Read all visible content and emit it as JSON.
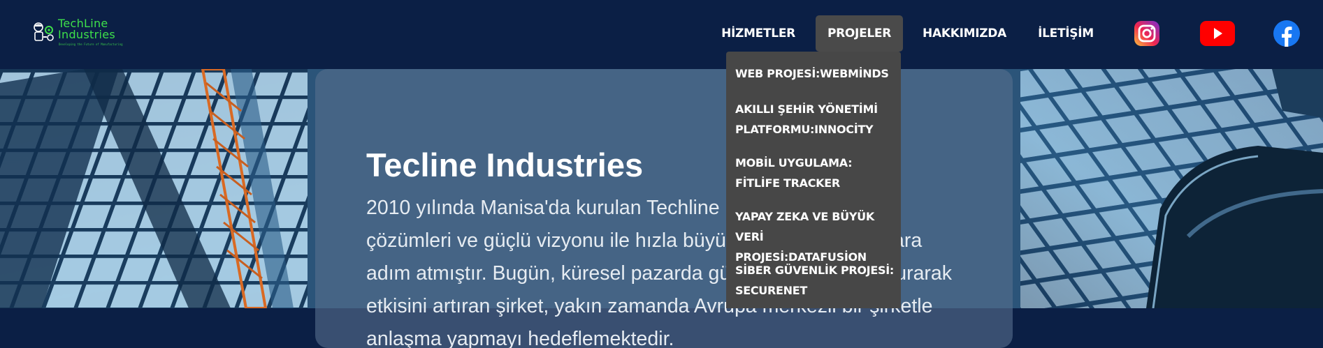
{
  "brand": {
    "title_line1": "TechLine",
    "title_line2": "Industries",
    "tagline": "Developing the Future of Manufacturing",
    "color": "#3ee04a"
  },
  "nav": {
    "items": [
      {
        "label": "HİZMETLER"
      },
      {
        "label": "PROJELER",
        "active": true
      },
      {
        "label": "HAKKIMIZDA"
      },
      {
        "label": "İLETİŞİM"
      }
    ],
    "social_icons": [
      "instagram-icon",
      "youtube-icon",
      "facebook-icon"
    ],
    "background": "#0b1f45",
    "active_background": "#4a4a4a"
  },
  "dropdown": {
    "items": [
      {
        "line1": "WEB PROJESİ:WEBMİNDS",
        "line2": ""
      },
      {
        "line1": "AKILLI ŞEHİR YÖNETİMİ",
        "line2": "PLATFORMU:INNOCİTY"
      },
      {
        "line1": "MOBİL UYGULAMA:",
        "line2": "FİTLİFE TRACKER"
      },
      {
        "line1": "YAPAY ZEKA VE BÜYÜK",
        "line2": "VERİ PROJESİ:DATAFUSİON"
      },
      {
        "line1": "SİBER GÜVENLİK PROJESİ:",
        "line2": "SECURENET"
      }
    ],
    "background": "#474747"
  },
  "hero": {
    "title": "Tecline Industries",
    "text": "2010 yılında Manisa'da kurulan Techline Industries, yenilikçi çözümleri ve güçlü vizyonu ile hızla büyüyerek global pazarlara adım atmıştır. Bugün, küresel pazarda güçlü iş bağlantıları kurarak etkisini artıran şirket, yakın zamanda Avrupa merkezli bir şirketle anlaşma yapmayı hedeflemektedir."
  }
}
